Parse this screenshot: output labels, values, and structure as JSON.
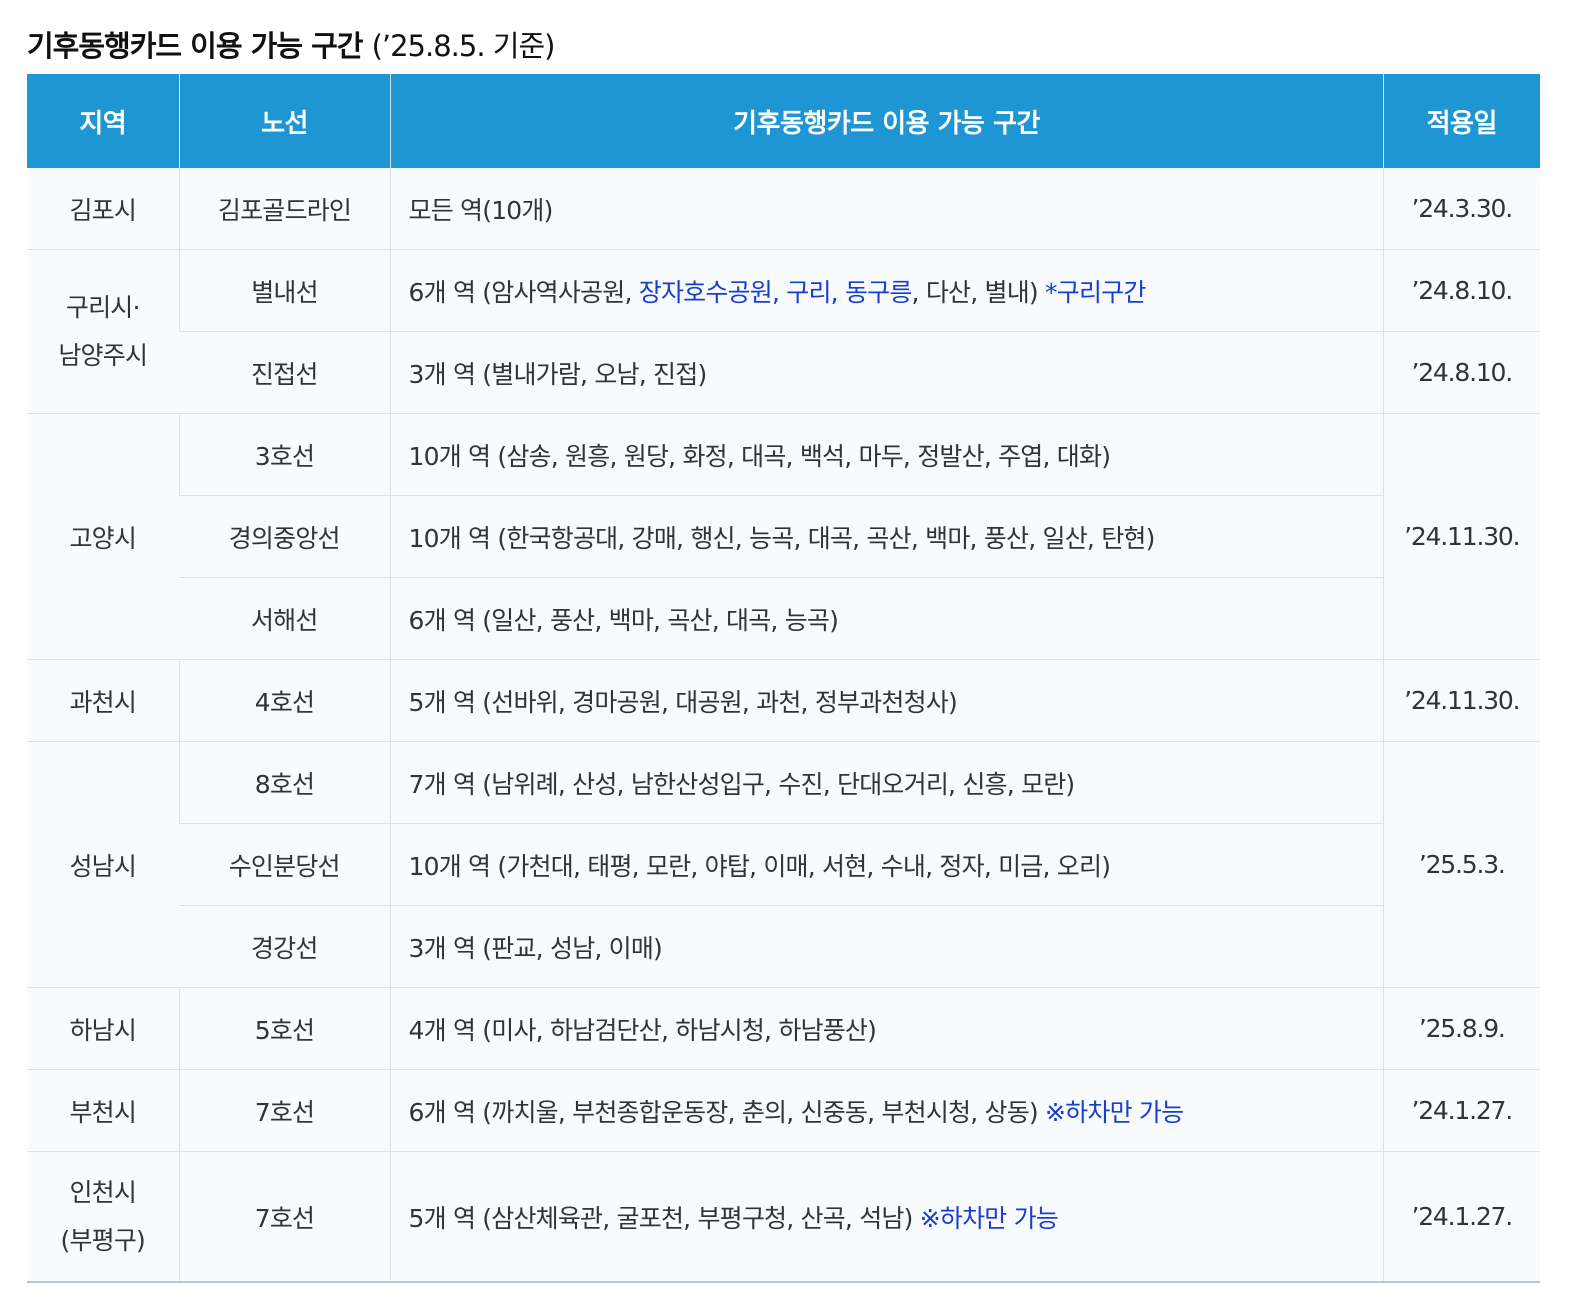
{
  "title": {
    "main": "기후동행카드 이용 가능 구간",
    "note": "(’25.8.5. 기준)"
  },
  "table": {
    "headers": [
      "지역",
      "노선",
      "기후동행카드 이용 가능 구간",
      "적용일"
    ],
    "rows": [
      {
        "region": "김포시",
        "line": "김포골드라인",
        "section": "모든 역(10개)",
        "date": "’24.3.30."
      },
      {
        "region_lines": [
          "구리시·",
          "남양주시"
        ],
        "line": "별내선",
        "section_a": "6개 역 (암사역사공원, ",
        "section_hl": "장자호수공원, 구리, 동구릉",
        "section_b": ", 다산, 별내) ",
        "section_note": "*구리구간",
        "date": "’24.8.10."
      },
      {
        "line": "진접선",
        "section": "3개 역 (별내가람, 오남, 진접)",
        "date": "’24.8.10."
      },
      {
        "region": "고양시",
        "line": "3호선",
        "section": "10개 역 (삼송, 원흥, 원당, 화정, 대곡, 백석, 마두, 정발산, 주엽, 대화)",
        "date": "’24.11.30."
      },
      {
        "line": "경의중앙선",
        "section": "10개 역 (한국항공대, 강매, 행신, 능곡, 대곡, 곡산, 백마, 풍산, 일산, 탄현)"
      },
      {
        "line": "서해선",
        "section": "6개 역 (일산, 풍산, 백마, 곡산, 대곡, 능곡)"
      },
      {
        "region": "과천시",
        "line": "4호선",
        "section": "5개 역 (선바위, 경마공원, 대공원, 과천, 정부과천청사)",
        "date": "’24.11.30."
      },
      {
        "region": "성남시",
        "line": "8호선",
        "section": "7개 역 (남위례, 산성, 남한산성입구, 수진, 단대오거리, 신흥, 모란)",
        "date": "’25.5.3."
      },
      {
        "line": "수인분당선",
        "section": "10개 역 (가천대, 태평, 모란, 야탑, 이매, 서현, 수내, 정자, 미금, 오리)"
      },
      {
        "line": "경강선",
        "section": "3개 역 (판교, 성남, 이매)"
      },
      {
        "region": "하남시",
        "line": "5호선",
        "section": "4개 역 (미사, 하남검단산, 하남시청, 하남풍산)",
        "date": "’25.8.9."
      },
      {
        "region": "부천시",
        "line": "7호선",
        "section": "6개 역 (까치울, 부천종합운동장, 춘의, 신중동, 부천시청, 상동) ",
        "section_note": "※하차만 가능",
        "date": "’24.1.27."
      },
      {
        "region_lines": [
          "인천시",
          "(부평구)"
        ],
        "line": "7호선",
        "section": "5개 역 (삼산체육관, 굴포천, 부평구청, 산곡, 석남) ",
        "section_note": "※하차만 가능",
        "date": "’24.1.27."
      }
    ]
  },
  "colors": {
    "header_bg": "#1e96d3",
    "header_text": "#ffffff",
    "highlight_text": "#1a3ccf",
    "row_bg": "#f7fbfd"
  }
}
